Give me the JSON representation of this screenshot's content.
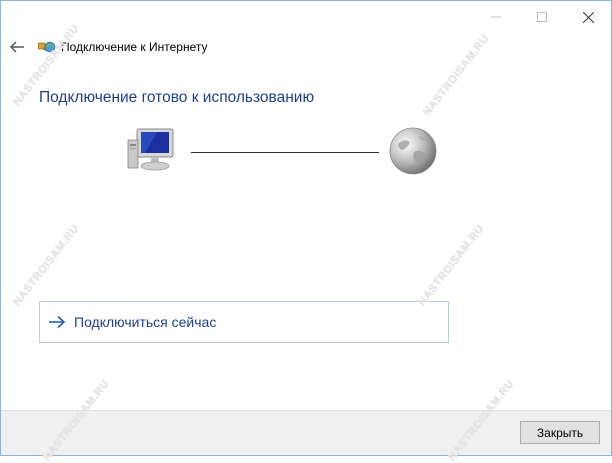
{
  "window": {
    "title": "Подключение к Интернету",
    "controls": {
      "minimize_icon": "minimize-icon",
      "maximize_icon": "maximize-icon",
      "close_icon": "close-icon"
    }
  },
  "header": {
    "back_icon": "back-arrow-icon",
    "app_icon": "network-connection-icon"
  },
  "main": {
    "heading": "Подключение готово к использованию",
    "diagram": {
      "computer_icon": "computer-icon",
      "globe_icon": "globe-icon"
    },
    "connect_option": {
      "label": "Подключиться сейчас",
      "icon": "arrow-right-icon"
    }
  },
  "footer": {
    "close_label": "Закрыть"
  },
  "watermark": {
    "text": "NASTROISAM.RU"
  },
  "colors": {
    "heading": "#1f3f8f",
    "link": "#1f3f8f",
    "window_border": "#8ab4d8",
    "footer_bg": "#f0f0f0"
  }
}
